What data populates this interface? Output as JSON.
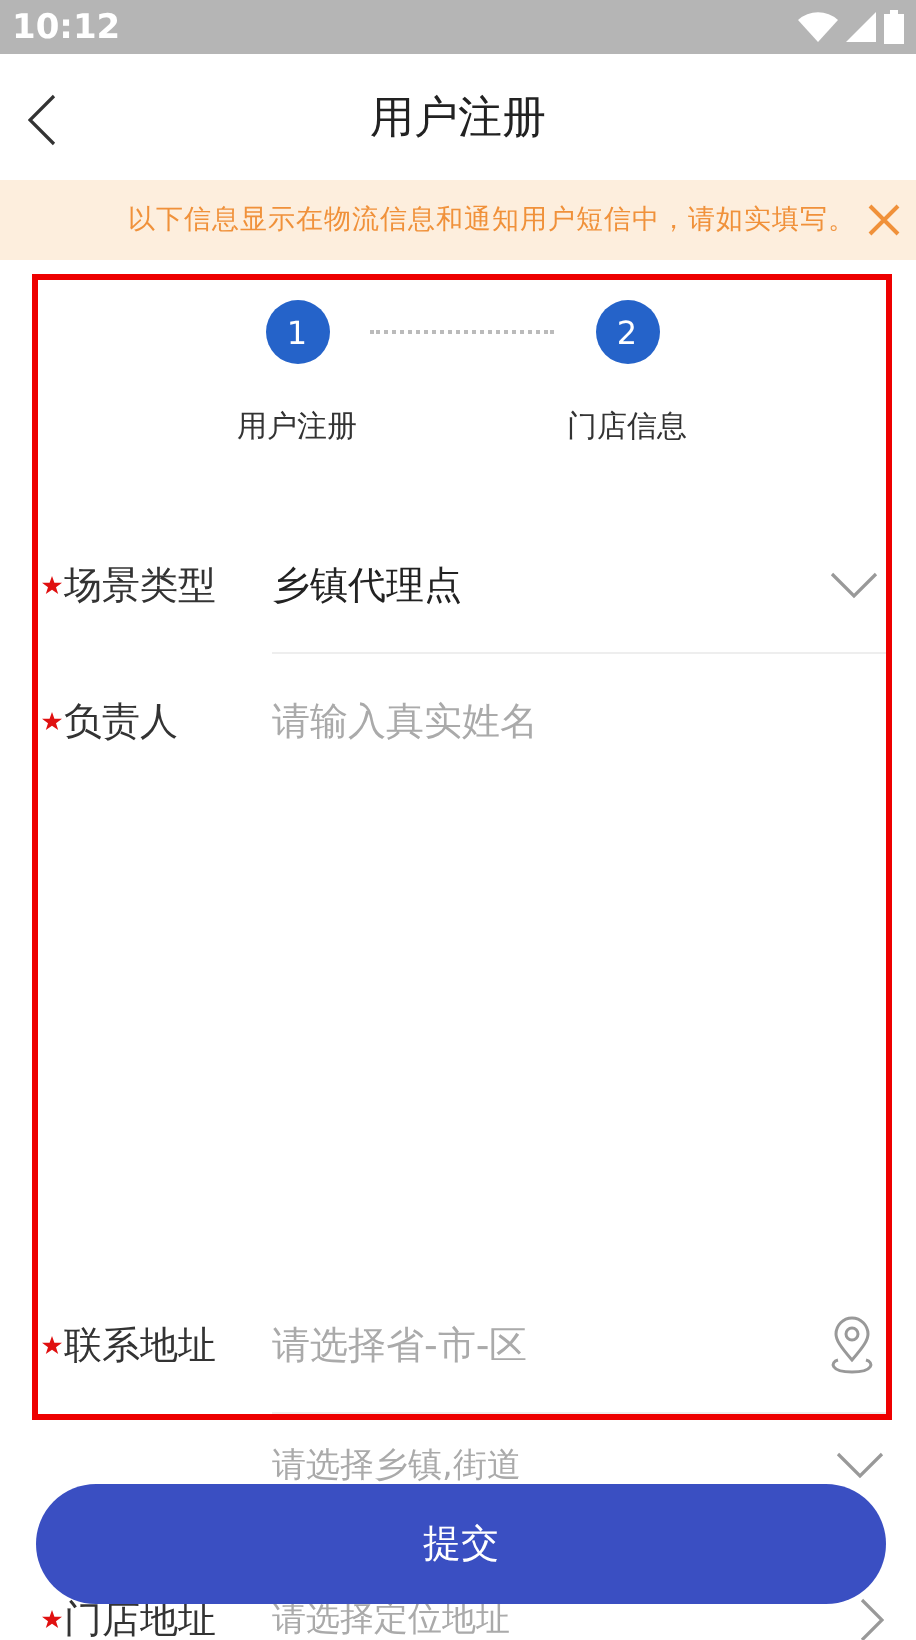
{
  "status_bar": {
    "time": "10:12"
  },
  "header": {
    "title": "用户注册"
  },
  "notice": {
    "text": "以下信息显示在物流信息和通知用户短信中，请如实填写。"
  },
  "steps": [
    {
      "number": "1",
      "label": "用户注册"
    },
    {
      "number": "2",
      "label": "门店信息"
    }
  ],
  "highlight_frame": {
    "fields": [
      {
        "kind": "select",
        "label": "场景类型",
        "required": true,
        "value": "乡镇代理点"
      },
      {
        "kind": "text",
        "label": "负责人",
        "required": true,
        "placeholder": "请输入真实姓名"
      },
      {
        "kind": "location",
        "label": "联系地址",
        "required": true,
        "placeholder": "请选择省-市-区"
      }
    ]
  },
  "more_fields": [
    {
      "kind": "select",
      "placeholder": "请选择乡镇,街道"
    },
    {
      "kind": "link",
      "label": "门店地址",
      "required": true,
      "placeholder": "请选择定位地址"
    }
  ],
  "submit_button": "提交"
}
